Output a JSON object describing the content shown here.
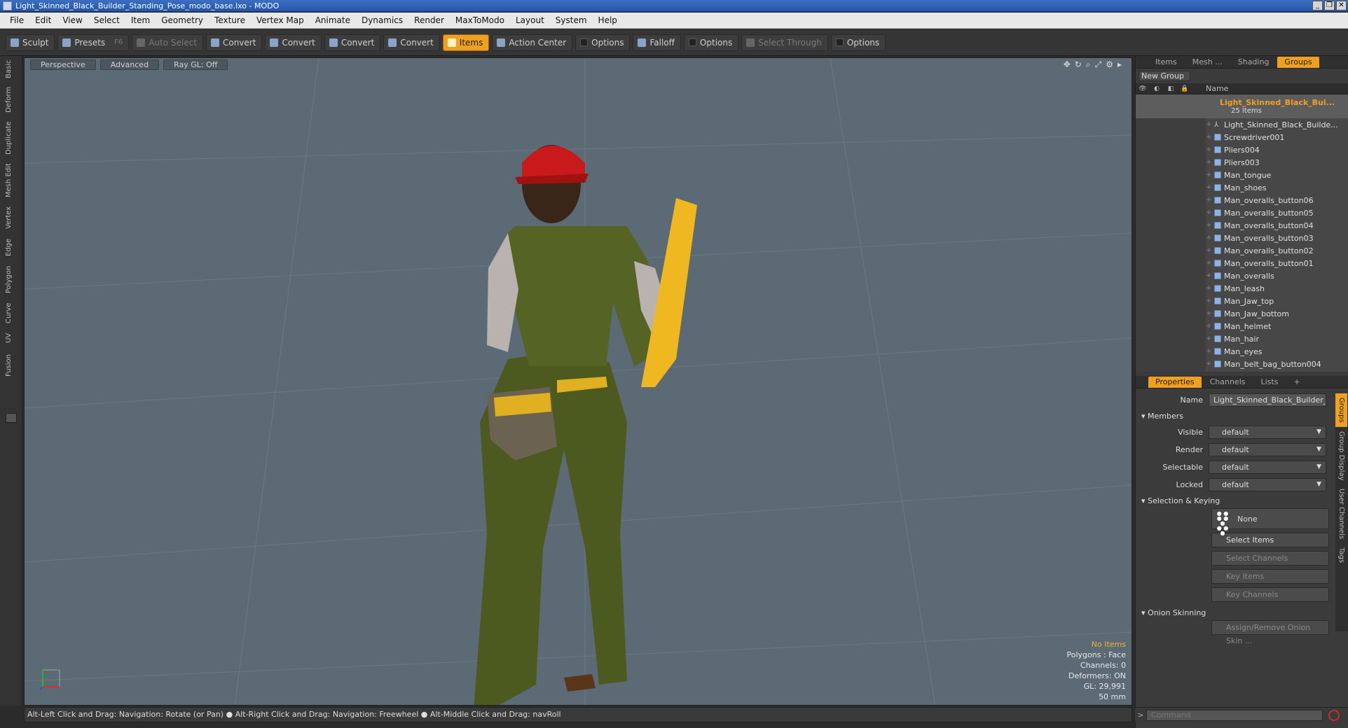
{
  "window": {
    "title": "Light_Skinned_Black_Builder_Standing_Pose_modo_base.lxo - MODO",
    "controls": [
      "_",
      "❐",
      "✕"
    ]
  },
  "menu": [
    "File",
    "Edit",
    "View",
    "Select",
    "Item",
    "Geometry",
    "Texture",
    "Vertex Map",
    "Animate",
    "Dynamics",
    "Render",
    "MaxToModo",
    "Layout",
    "System",
    "Help"
  ],
  "toolbar": [
    {
      "label": "Sculpt",
      "state": "normal"
    },
    {
      "label": "Presets",
      "key": "F6",
      "state": "normal"
    },
    {
      "label": "Auto Select",
      "state": "disabled"
    },
    {
      "label": "Convert",
      "state": "normal"
    },
    {
      "label": "Convert",
      "state": "normal"
    },
    {
      "label": "Convert",
      "state": "normal"
    },
    {
      "label": "Convert",
      "state": "normal"
    },
    {
      "label": "Items",
      "state": "active"
    },
    {
      "label": "Action Center",
      "state": "normal"
    },
    {
      "label": "Options",
      "state": "check"
    },
    {
      "label": "Falloff",
      "state": "normal"
    },
    {
      "label": "Options",
      "state": "check"
    },
    {
      "label": "Select Through",
      "state": "disabled"
    },
    {
      "label": "Options",
      "state": "check"
    }
  ],
  "left_tabs": [
    "Basic",
    "Deform",
    "Duplicate",
    "Mesh Edit",
    "Vertex",
    "Edge",
    "Polygon",
    "Curve",
    "UV",
    "Fusion"
  ],
  "viewport": {
    "buttons": [
      "Perspective",
      "Advanced",
      "Ray GL: Off"
    ],
    "icons": [
      "move-icon",
      "rotate-icon",
      "zoom-icon",
      "maximize-icon",
      "gear-icon",
      "arrow-right-icon"
    ],
    "hud": {
      "items": "No Items",
      "polygons": "Polygons : Face",
      "channels": "Channels: 0",
      "deformers": "Deformers: ON",
      "gl": "GL: 29,991",
      "scale": "50 mm"
    }
  },
  "status": "Alt-Left Click and Drag: Navigation: Rotate (or Pan) ● Alt-Right Click and Drag: Navigation: Freewheel ● Alt-Middle Click and Drag: navRoll",
  "groups_panel": {
    "tabs": [
      "Items",
      "Mesh ...",
      "Shading",
      "Groups"
    ],
    "active_tab": "Groups",
    "new_group": "New Group",
    "column_name": "Name",
    "group": {
      "name": "Light_Skinned_Black_Bui...",
      "count": "25 Items"
    },
    "items": [
      "Light_Skinned_Black_Builde...",
      "Screwdriver001",
      "Pliers004",
      "Pliers003",
      "Man_tongue",
      "Man_shoes",
      "Man_overalls_button06",
      "Man_overalls_button05",
      "Man_overalls_button04",
      "Man_overalls_button03",
      "Man_overalls_button02",
      "Man_overalls_button01",
      "Man_overalls",
      "Man_leash",
      "Man_Jaw_top",
      "Man_Jaw_bottom",
      "Man_helmet",
      "Man_hair",
      "Man_eyes",
      "Man_belt_bag_button004"
    ]
  },
  "properties": {
    "tabs": [
      "Properties",
      "Channels",
      "Lists",
      "+"
    ],
    "name_label": "Name",
    "name_value": "Light_Skinned_Black_Builder_Sta",
    "members": "Members",
    "fields": [
      {
        "label": "Visible",
        "value": "default"
      },
      {
        "label": "Render",
        "value": "default"
      },
      {
        "label": "Selectable",
        "value": "default"
      },
      {
        "label": "Locked",
        "value": "default"
      }
    ],
    "selection_keying": "Selection & Keying",
    "none_label": "None",
    "buttons": [
      {
        "label": "Select Items",
        "enabled": true
      },
      {
        "label": "Select Channels",
        "enabled": false
      },
      {
        "label": "Key Items",
        "enabled": false
      },
      {
        "label": "Key Channels",
        "enabled": false
      }
    ],
    "onion": "Onion Skinning",
    "onion_button": "Assign/Remove Onion Skin ...",
    "side_tabs": [
      "Groups",
      "Group Display",
      "User Channels",
      "Tags"
    ]
  },
  "command": {
    "placeholder": "Command",
    "prompt": ">"
  }
}
